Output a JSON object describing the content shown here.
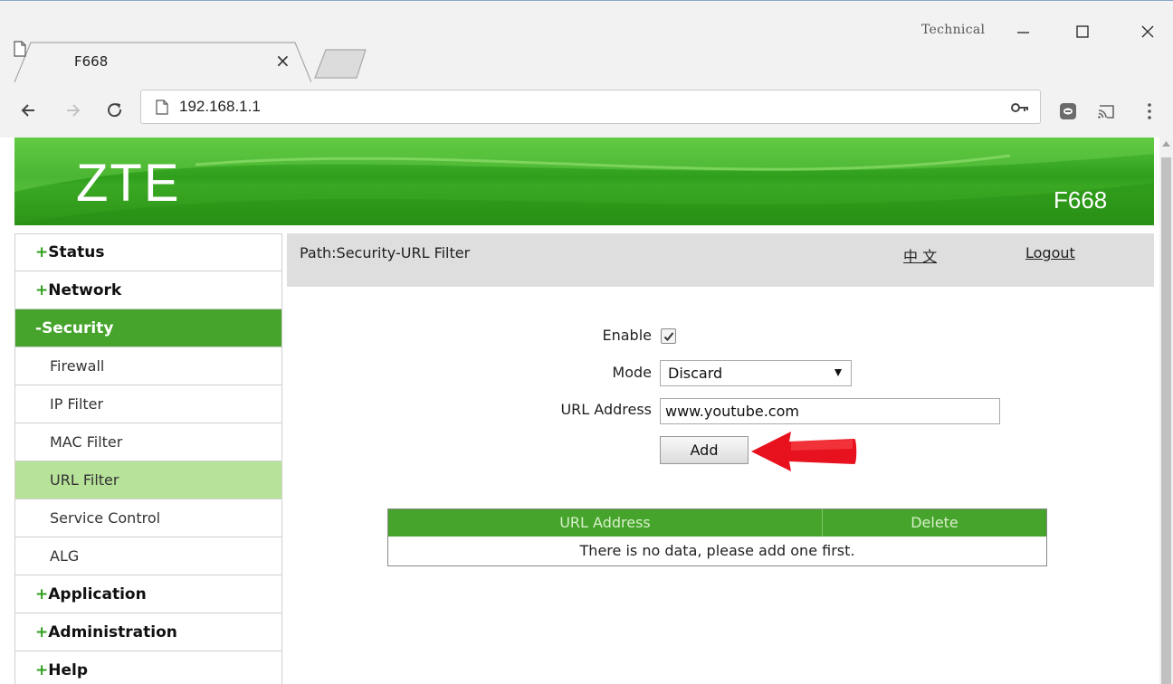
{
  "browser": {
    "tab_title": "F668",
    "tab_close_glyph": "×",
    "profile_label": "Technical",
    "window_minimize": "–",
    "window_maximize": "☐",
    "window_close": "✕",
    "url": "192.168.1.1",
    "icons": {
      "back": "back-arrow-icon",
      "forward": "forward-arrow-icon",
      "reload": "reload-icon",
      "page": "page-icon",
      "key": "key-icon",
      "extension": "extension-icon",
      "cast": "cast-icon",
      "menu": "more-vert-icon"
    }
  },
  "banner": {
    "logo": "ZTE",
    "model": "F668",
    "color": "#3aa823"
  },
  "sidebar": {
    "items": [
      {
        "label": "Status",
        "sign": "+",
        "type": "top",
        "state": "collapsed"
      },
      {
        "label": "Network",
        "sign": "+",
        "type": "top",
        "state": "collapsed"
      },
      {
        "label": "Security",
        "sign": "-",
        "type": "top",
        "state": "open"
      },
      {
        "label": "Firewall",
        "type": "sub"
      },
      {
        "label": "IP Filter",
        "type": "sub"
      },
      {
        "label": "MAC Filter",
        "type": "sub"
      },
      {
        "label": "URL Filter",
        "type": "sub",
        "state": "active"
      },
      {
        "label": "Service Control",
        "type": "sub"
      },
      {
        "label": "ALG",
        "type": "sub"
      },
      {
        "label": "Application",
        "sign": "+",
        "type": "top",
        "state": "collapsed"
      },
      {
        "label": "Administration",
        "sign": "+",
        "type": "top",
        "state": "collapsed"
      },
      {
        "label": "Help",
        "sign": "+",
        "type": "top",
        "state": "collapsed"
      }
    ],
    "colors": {
      "open": "#46a42c",
      "active": "#b7e29a"
    }
  },
  "header": {
    "path": "Path:Security-URL Filter",
    "lang_link": "中 文",
    "logout": "Logout"
  },
  "form": {
    "enable_label": "Enable",
    "enable_checked": true,
    "mode_label": "Mode",
    "mode_value": "Discard",
    "url_label": "URL Address",
    "url_value": "www.youtube.com",
    "add_button": "Add"
  },
  "table": {
    "columns": [
      "URL Address",
      "Delete"
    ],
    "empty_message": "There is no data, please add one first."
  },
  "annotation": {
    "arrow_color": "#e8121e",
    "arrow_icon": "red-pointer-arrow-icon"
  }
}
